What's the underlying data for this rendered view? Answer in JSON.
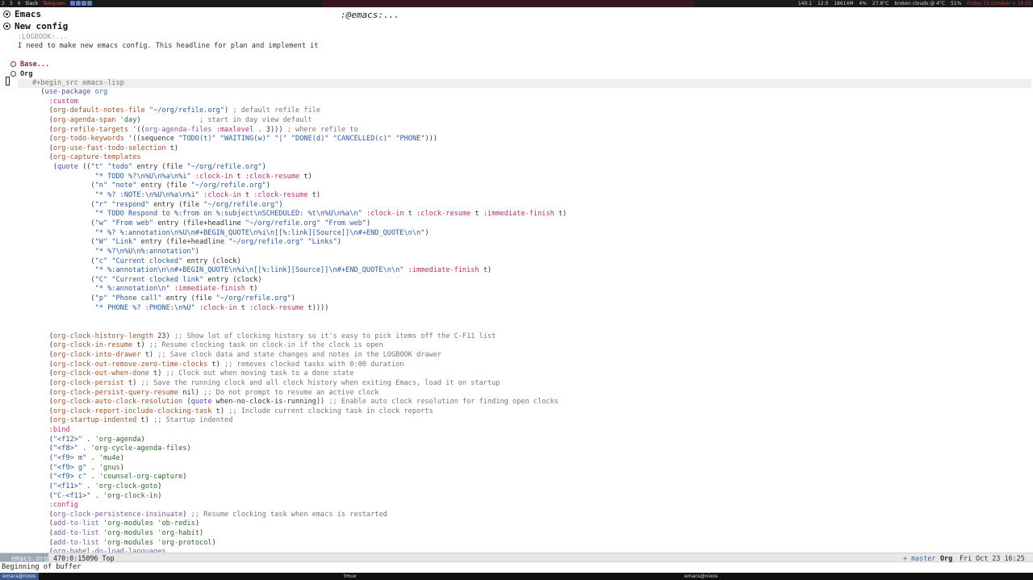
{
  "topbar": {
    "workspaces": [
      "2",
      "3",
      "4",
      "Slack",
      "Telegram"
    ],
    "status": [
      "140.1",
      "12.0",
      "18614M",
      "4%",
      "27.8°C",
      "broken clouds @ 4°C",
      "51%",
      "Friday 23 October > 16:25"
    ]
  },
  "editor": {
    "heading_emacs": "Emacs",
    "window_title": ":@emacs:...",
    "heading_new_config": "New config",
    "logbook": ":LOGBOOK:...",
    "description": "I need to make new emacs config. This headline for plan and implement it",
    "sub_base": "Base...",
    "sub_org": "Org",
    "src_begin": "#+begin_src emacs-lisp"
  },
  "modeline": {
    "buffer": "emacs.org",
    "position": "470:0:15096 Top",
    "branch": "+ master",
    "mode": "Org",
    "datetime": "Fri Oct 23 16:25"
  },
  "echo": "Beginning of buffer",
  "bottombar": {
    "session1": "emacs@nixos",
    "session2": "tmux",
    "session3": "emacs@nixos"
  }
}
